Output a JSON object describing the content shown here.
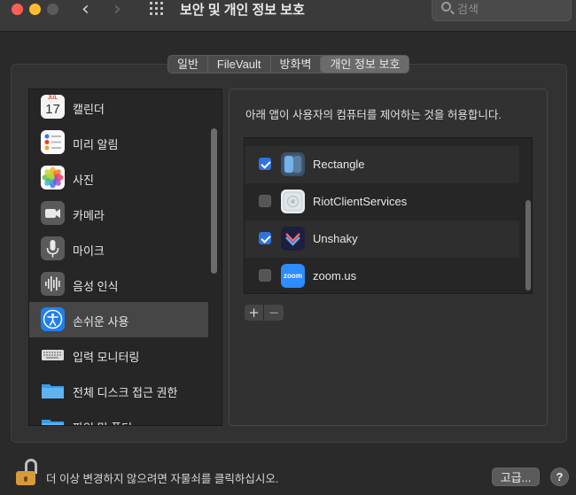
{
  "window": {
    "title": "보안 및 개인 정보 보호",
    "search_placeholder": "검색"
  },
  "tabs": [
    {
      "label": "일반",
      "active": false
    },
    {
      "label": "FileVault",
      "active": false
    },
    {
      "label": "방화벽",
      "active": false
    },
    {
      "label": "개인 정보 보호",
      "active": true
    }
  ],
  "sidebar": {
    "items": [
      {
        "label": "캘린더",
        "icon": "calendar-icon",
        "calendar_month": "JUL",
        "calendar_day": "17"
      },
      {
        "label": "미리 알림",
        "icon": "reminders-icon"
      },
      {
        "label": "사진",
        "icon": "photos-icon"
      },
      {
        "label": "카메라",
        "icon": "camera-icon"
      },
      {
        "label": "마이크",
        "icon": "microphone-icon"
      },
      {
        "label": "음성 인식",
        "icon": "speech-recognition-icon"
      },
      {
        "label": "손쉬운 사용",
        "icon": "accessibility-icon",
        "selected": true
      },
      {
        "label": "입력 모니터링",
        "icon": "keyboard-icon"
      },
      {
        "label": "전체 디스크 접근 권한",
        "icon": "folder-icon"
      },
      {
        "label": "파일 및 폴더",
        "icon": "folder-icon"
      }
    ]
  },
  "right_panel": {
    "description": "아래 앱이 사용자의 컴퓨터를 제어하는 것을 허용합니다.",
    "apps": [
      {
        "name": "Rectangle",
        "checked": true,
        "icon": "rectangle-app-icon"
      },
      {
        "name": "RiotClientServices",
        "checked": false,
        "icon": "riot-client-icon"
      },
      {
        "name": "Unshaky",
        "checked": true,
        "icon": "unshaky-app-icon"
      },
      {
        "name": "zoom.us",
        "checked": false,
        "icon": "zoom-app-icon",
        "icon_text": "zoom"
      }
    ],
    "add_label": "+",
    "remove_label": "−"
  },
  "footer": {
    "lock_text": "더 이상 변경하지 않으려면 자물쇠를 클릭하십시오.",
    "advanced_label": "고급...",
    "help_label": "?"
  },
  "colors": {
    "accent": "#2f72e2",
    "selection": "#464646",
    "background": "#2a2a2a"
  }
}
